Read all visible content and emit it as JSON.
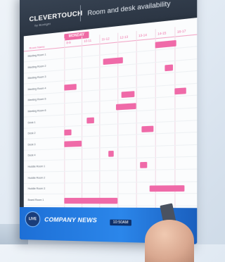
{
  "brand": {
    "name": "CLEVERTOUCH",
    "sub": "by Boxlight"
  },
  "title": "Room and desk availability",
  "day": "MONDAY",
  "row_header": "Room Name",
  "time_slots": [
    "8-9",
    "10-11",
    "11-12",
    "12-13",
    "13-14",
    "14-15",
    "16-17"
  ],
  "rooms": [
    "Meeting Room 1",
    "Meeting Room 2",
    "Meeting Room 3",
    "Meeting Room 4",
    "Meeting Room 5",
    "Meeting Room 6",
    "Desk 1",
    "Desk 2",
    "Desk 3",
    "Desk 4",
    "Huddle Room 1",
    "Huddle Room 2",
    "Huddle Room 3",
    "Board Room 1"
  ],
  "bookings": [
    {
      "room": 0,
      "start": 5.0,
      "end": 6.1
    },
    {
      "room": 1,
      "start": 2.2,
      "end": 3.3
    },
    {
      "room": 2,
      "start": 5.5,
      "end": 5.9
    },
    {
      "room": 3,
      "start": 0.0,
      "end": 0.7
    },
    {
      "room": 4,
      "start": 3.2,
      "end": 3.9
    },
    {
      "room": 4,
      "start": 6.0,
      "end": 6.6
    },
    {
      "room": 5,
      "start": 2.9,
      "end": 4.0
    },
    {
      "room": 6,
      "start": 1.3,
      "end": 1.7
    },
    {
      "room": 7,
      "start": 0.0,
      "end": 0.4
    },
    {
      "room": 7,
      "start": 4.3,
      "end": 4.9
    },
    {
      "room": 8,
      "start": 0.0,
      "end": 1.0
    },
    {
      "room": 9,
      "start": 2.5,
      "end": 2.8
    },
    {
      "room": 10,
      "start": 4.2,
      "end": 4.6
    },
    {
      "room": 12,
      "start": 4.7,
      "end": 6.5
    },
    {
      "room": 13,
      "start": 0.0,
      "end": 3.0
    }
  ],
  "news": {
    "live_label": "LIVE",
    "title": "COMPANY NEWS",
    "time": "10:50AM"
  },
  "colors": {
    "accent": "#ef6aa8",
    "header": "#2c3644",
    "news": "#1d6fd6"
  }
}
